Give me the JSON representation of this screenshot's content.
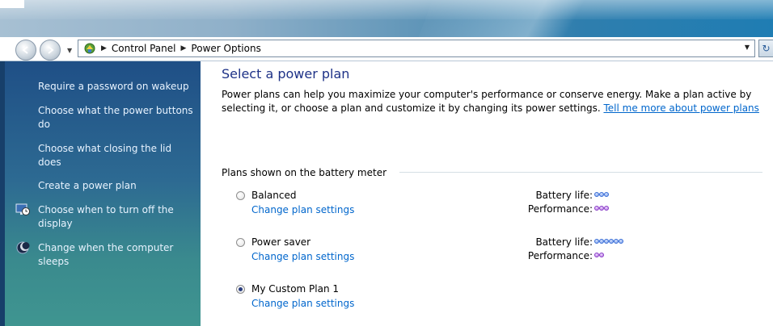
{
  "window": {
    "breadcrumb": [
      "Control Panel",
      "Power Options"
    ]
  },
  "sidebar": {
    "tasks": [
      {
        "label": "Require a password on wakeup",
        "icon": null
      },
      {
        "label": "Choose what the power buttons do",
        "icon": null
      },
      {
        "label": "Choose what closing the lid does",
        "icon": null
      },
      {
        "label": "Create a power plan",
        "icon": null
      },
      {
        "label": "Choose when to turn off the display",
        "icon": "monitor-clock-icon"
      },
      {
        "label": "Change when the computer sleeps",
        "icon": "moon-icon"
      }
    ]
  },
  "main": {
    "title": "Select a power plan",
    "description": "Power plans can help you maximize your computer's performance or conserve energy. Make a plan active by selecting it, or choose a plan and customize it by changing its power settings.",
    "learn_more": "Tell me more about power plans",
    "group_label": "Plans shown on the battery meter",
    "plans": [
      {
        "name": "Balanced",
        "link": "Change plan settings",
        "selected": false,
        "battery_life_label": "Battery life:",
        "battery_life": 3,
        "performance_label": "Performance:",
        "performance": 3
      },
      {
        "name": "Power saver",
        "link": "Change plan settings",
        "selected": false,
        "battery_life_label": "Battery life:",
        "battery_life": 6,
        "performance_label": "Performance:",
        "performance": 2
      },
      {
        "name": "My Custom Plan 1",
        "link": "Change plan settings",
        "selected": true
      }
    ]
  },
  "colors": {
    "link": "#0066cc",
    "title": "#1e3287",
    "sidebar_text": "#e8f3ff",
    "battery_dot": "#6d95e8",
    "performance_dot": "#b06ae0"
  }
}
